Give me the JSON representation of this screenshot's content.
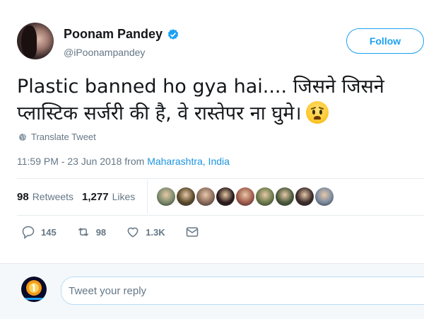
{
  "user": {
    "name": "Poonam Pandey",
    "handle": "@iPoonampandey",
    "verified": true
  },
  "follow_label": "Follow",
  "tweet": {
    "text": "Plastic banned ho gya hai.... जिसने जिसने प्लास्टिक सर्जरी की है, वे रास्तेपर ना घुमे।",
    "emoji": "anxious-face"
  },
  "translate_label": "Translate Tweet",
  "timestamp": {
    "time": "11:59 PM - 23 Jun 2018 from ",
    "location": "Maharashtra, India"
  },
  "stats": {
    "retweets_count": "98",
    "retweets_label": "Retweets",
    "likes_count": "1,277",
    "likes_label": "Likes"
  },
  "likers": [
    "#7a8a6a",
    "#5a4a2a",
    "#8a6a5a",
    "#2a1a1a",
    "#a05a4a",
    "#6a7a4a",
    "#4a5a3a",
    "#3a2a2a",
    "#7a8aa0"
  ],
  "actions": {
    "reply_count": "145",
    "retweet_count": "98",
    "like_count": "1.3K"
  },
  "reply": {
    "placeholder": "Tweet your reply"
  },
  "colors": {
    "accent": "#1da1f2",
    "link": "#1b95e0",
    "muted": "#657786",
    "text": "#14171a"
  }
}
